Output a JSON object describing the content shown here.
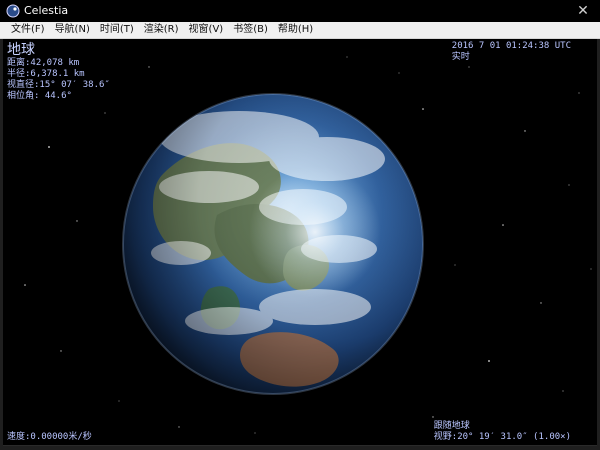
{
  "window": {
    "title": "Celestia",
    "icon": "celestia-app-icon",
    "close_glyph": "✕"
  },
  "menu": {
    "items": [
      {
        "label": "文件(F)"
      },
      {
        "label": "导航(N)"
      },
      {
        "label": "时间(T)"
      },
      {
        "label": "渲染(R)"
      },
      {
        "label": "视窗(V)"
      },
      {
        "label": "书签(B)"
      },
      {
        "label": "帮助(H)"
      }
    ]
  },
  "hud": {
    "object_name": "地球",
    "distance": "距离:42,078 km",
    "radius": "半径:6,378.1 km",
    "apparent_diameter": "视直径:15° 07′ 38.6″",
    "phase_angle": "相位角: 44.6°",
    "datetime": "2016 7 01 01:24:38 UTC",
    "time_mode": "实时",
    "speed": "速度:0.00000米/秒",
    "follow": "跟随地球",
    "fov": "视野:20° 19′ 31.0″ (1.00×)"
  },
  "colors": {
    "hud_text": "#b9c5ff",
    "space": "#000000",
    "menubar": "#f0f0f0",
    "titlebar": "#000000"
  }
}
